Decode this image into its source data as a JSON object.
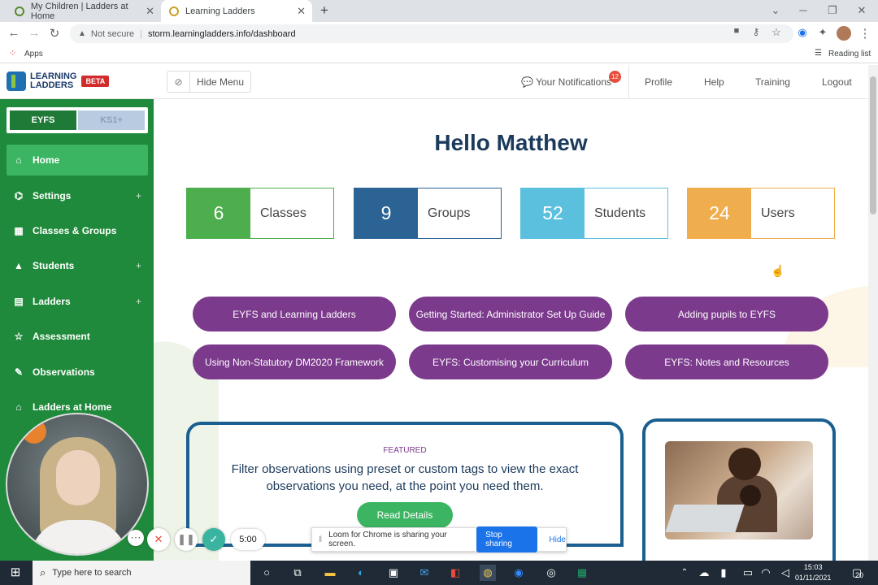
{
  "browser": {
    "tabs": [
      {
        "title": "My Children | Ladders at Home"
      },
      {
        "title": "Learning Ladders"
      }
    ],
    "new_tab_symbol": "+",
    "security_label": "Not secure",
    "url": "storm.learningladders.info/dashboard",
    "bookmarks": {
      "apps": "Apps",
      "reading_list": "Reading list"
    }
  },
  "header": {
    "logo_line1": "LEARNING",
    "logo_line2": "LADDERS",
    "beta": "BETA",
    "hide_menu": "Hide Menu",
    "notifications": "Your Notifications",
    "notifications_count": "12",
    "links": [
      "Profile",
      "Help",
      "Training",
      "Logout"
    ]
  },
  "sidebar": {
    "stages": [
      "EYFS",
      "KS1+"
    ],
    "items": [
      {
        "label": "Home",
        "icon": "home-icon",
        "plus": false
      },
      {
        "label": "Settings",
        "icon": "bank-icon",
        "plus": true
      },
      {
        "label": "Classes & Groups",
        "icon": "grid-icon",
        "plus": false
      },
      {
        "label": "Students",
        "icon": "graduation-cap-icon",
        "plus": true
      },
      {
        "label": "Ladders",
        "icon": "book-icon",
        "plus": true
      },
      {
        "label": "Assessment",
        "icon": "star-icon",
        "plus": false
      },
      {
        "label": "Observations",
        "icon": "pencil-icon",
        "plus": false
      },
      {
        "label": "Ladders at Home",
        "icon": "house-icon",
        "plus": false
      }
    ],
    "plus_symbol": "+"
  },
  "main": {
    "greeting": "Hello Matthew",
    "stats": [
      {
        "value": "6",
        "label": "Classes",
        "color": "#4cae4c"
      },
      {
        "value": "9",
        "label": "Groups",
        "color": "#2b6394"
      },
      {
        "value": "52",
        "label": "Students",
        "color": "#5bc0de"
      },
      {
        "value": "24",
        "label": "Users",
        "color": "#f0ad4e"
      }
    ],
    "guides": [
      "EYFS and Learning Ladders",
      "Getting Started: Administrator Set Up Guide",
      "Adding pupils to EYFS",
      "Using Non-Statutory DM2020 Framework",
      "EYFS: Customising your Curriculum",
      "EYFS: Notes and Resources"
    ],
    "featured": {
      "tag": "FEATURED",
      "message": "Filter observations using preset or custom tags to view the exact observations you need, at the point you need them.",
      "button": "Read Details"
    }
  },
  "loom": {
    "timer": "5:00",
    "share_text": "Loom for Chrome is sharing your screen.",
    "stop": "Stop sharing",
    "hide": "Hide"
  },
  "taskbar": {
    "search_placeholder": "Type here to search",
    "time": "15:03",
    "date": "01/11/2021",
    "notification_count": "20"
  },
  "colors": {
    "sidebar_green": "#1f8a3b",
    "active_green": "#3cb562",
    "guide_purple": "#7b3a8c",
    "navy": "#1b3a5c"
  }
}
